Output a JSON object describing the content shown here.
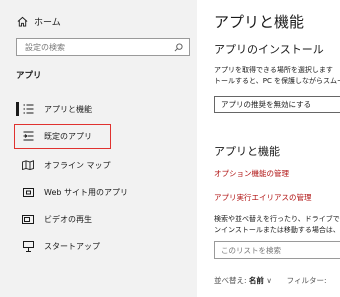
{
  "sidebar": {
    "home_label": "ホーム",
    "search_placeholder": "設定の検索",
    "section_title": "アプリ",
    "items": [
      {
        "label": "アプリと機能",
        "icon": "apps-list-icon",
        "selected": true
      },
      {
        "label": "既定のアプリ",
        "icon": "default-apps-icon",
        "selected": false
      },
      {
        "label": "オフライン マップ",
        "icon": "offline-map-icon",
        "selected": false
      },
      {
        "label": "Web サイト用のアプリ",
        "icon": "website-apps-icon",
        "selected": false
      },
      {
        "label": "ビデオの再生",
        "icon": "video-playback-icon",
        "selected": false
      },
      {
        "label": "スタートアップ",
        "icon": "startup-icon",
        "selected": false
      }
    ]
  },
  "main": {
    "title": "アプリと機能",
    "install_title": "アプリのインストール",
    "install_desc_line1": "アプリを取得できる場所を選択します",
    "install_desc_line2": "トールすると、PC を保護しながらスムー",
    "install_dropdown_value": "アプリの推奨を無効にする",
    "apps_title": "アプリと機能",
    "link_optional_features": "オプション機能の管理",
    "link_app_aliases": "アプリ実行エイリアスの管理",
    "search_desc_line1": "検索や並べ替えを行ったり、ドライブで",
    "search_desc_line2": "ンインストールまたは移動する場合は、",
    "list_search_placeholder": "このリストを検索",
    "sort_label": "並べ替え:",
    "sort_value": "名前",
    "sort_chevron": "∨",
    "filter_label": "フィルター:"
  },
  "colors": {
    "sidebar_bg": "#f2f2f2",
    "highlight_border": "#e0322f",
    "link_color": "#b01212"
  }
}
